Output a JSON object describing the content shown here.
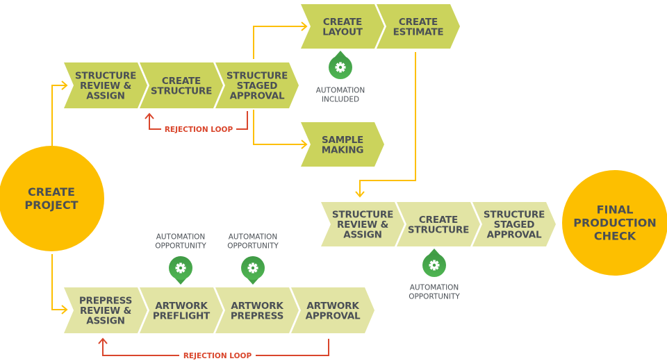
{
  "colors": {
    "step_dark": "#cbd35c",
    "step_light": "#e2e4a4",
    "circle": "#fdbf00",
    "connector": "#fdbf00",
    "rejection": "#d9452b",
    "automation_badge": "#43a047",
    "text": "#4a4f55"
  },
  "start": {
    "label": [
      "CREATE",
      "PROJECT"
    ]
  },
  "end": {
    "label": [
      "FINAL",
      "PRODUCTION",
      "CHECK"
    ]
  },
  "structure_row": {
    "steps": [
      {
        "label": [
          "STRUCTURE",
          "REVIEW &",
          "ASSIGN"
        ]
      },
      {
        "label": [
          "CREATE",
          "STRUCTURE"
        ]
      },
      {
        "label": [
          "STRUCTURE",
          "STAGED",
          "APPROVAL"
        ]
      }
    ],
    "rejection_label": "REJECTION LOOP"
  },
  "layout_row": {
    "steps": [
      {
        "label": [
          "CREATE",
          "LAYOUT"
        ]
      },
      {
        "label": [
          "CREATE",
          "ESTIMATE"
        ]
      }
    ],
    "automation": {
      "icon": "gear-icon",
      "label": [
        "AUTOMATION",
        "INCLUDED"
      ]
    }
  },
  "sample_row": {
    "steps": [
      {
        "label": [
          "SAMPLE",
          "MAKING"
        ]
      }
    ]
  },
  "final_structure_row": {
    "steps": [
      {
        "label": [
          "STRUCTURE",
          "REVIEW &",
          "ASSIGN"
        ]
      },
      {
        "label": [
          "CREATE",
          "STRUCTURE"
        ]
      },
      {
        "label": [
          "STRUCTURE",
          "STAGED",
          "APPROVAL"
        ]
      }
    ],
    "automation": {
      "icon": "gear-icon",
      "label": [
        "AUTOMATION",
        "OPPORTUNITY"
      ]
    }
  },
  "prepress_row": {
    "steps": [
      {
        "label": [
          "PREPRESS",
          "REVIEW &",
          "ASSIGN"
        ]
      },
      {
        "label": [
          "ARTWORK",
          "PREFLIGHT"
        ]
      },
      {
        "label": [
          "ARTWORK",
          "PREPRESS"
        ]
      },
      {
        "label": [
          "ARTWORK",
          "APPROVAL"
        ]
      }
    ],
    "automations": [
      {
        "icon": "gear-icon",
        "label": [
          "AUTOMATION",
          "OPPORTUNITY"
        ]
      },
      {
        "icon": "gear-icon",
        "label": [
          "AUTOMATION",
          "OPPORTUNITY"
        ]
      }
    ],
    "rejection_label": "REJECTION LOOP"
  }
}
